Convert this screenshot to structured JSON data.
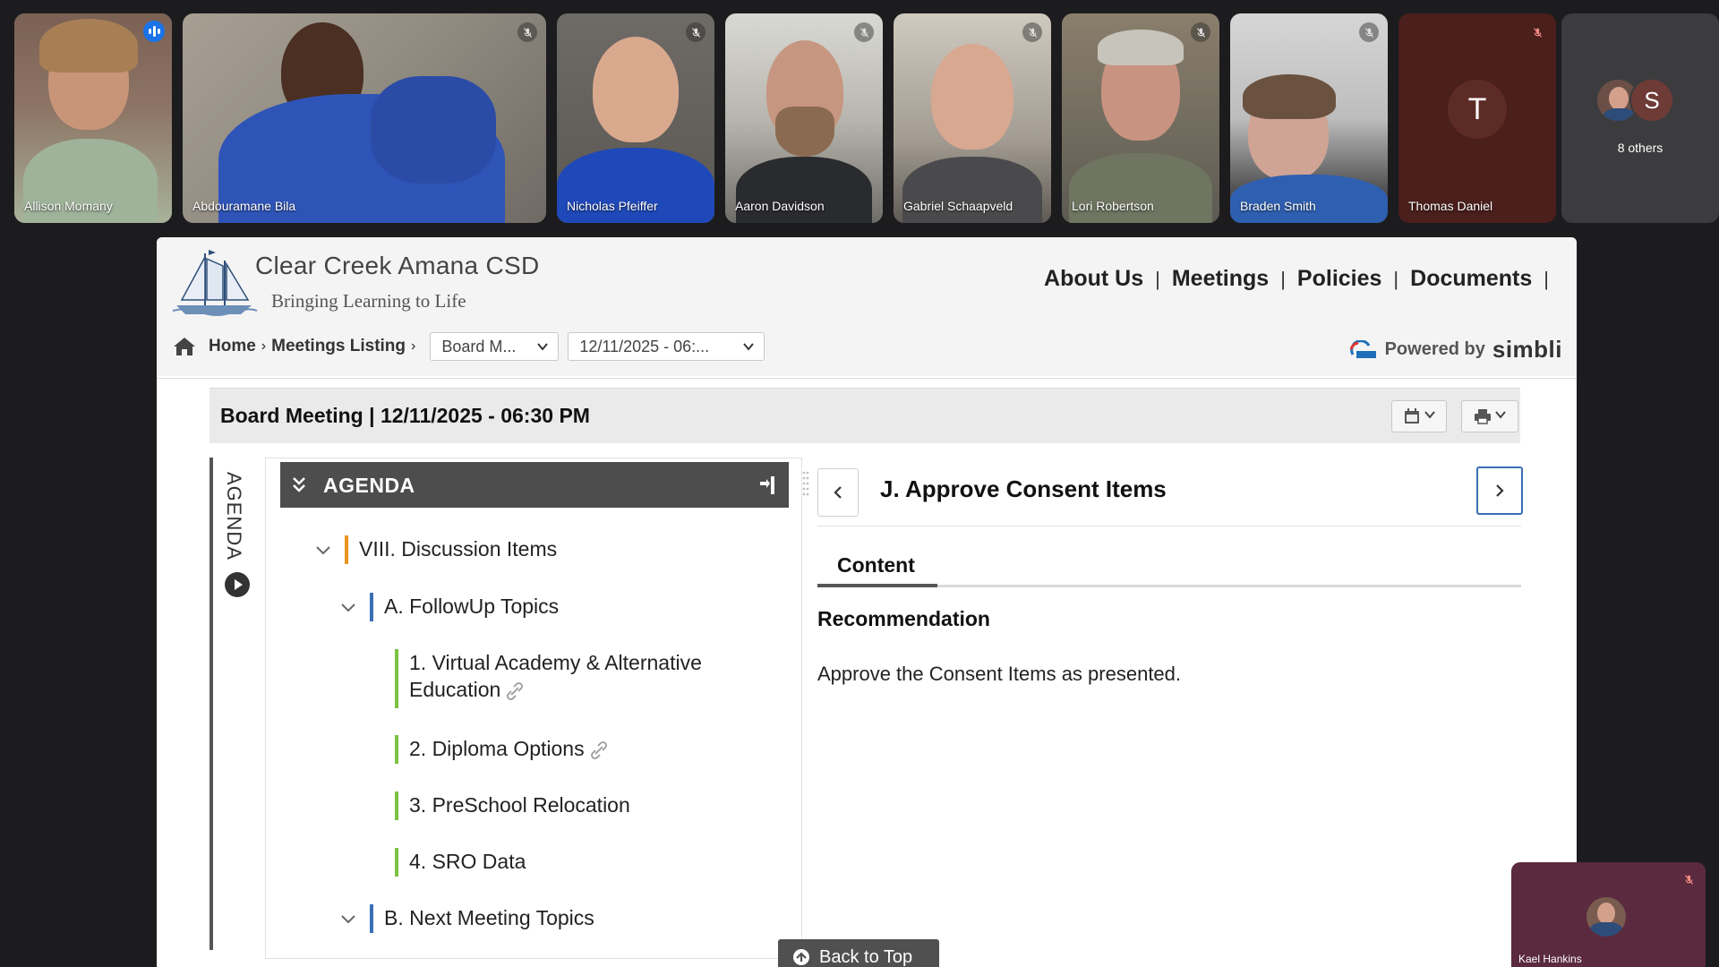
{
  "call": {
    "participants": [
      {
        "name": "Allison Momany",
        "speaking": true
      },
      {
        "name": "Abdouramane Bila",
        "muted": true
      },
      {
        "name": "Nicholas Pfeiffer",
        "muted": true
      },
      {
        "name": "Aaron Davidson",
        "muted": true
      },
      {
        "name": "Gabriel Schaapveld",
        "muted": true
      },
      {
        "name": "Lori Robertson",
        "muted": true
      },
      {
        "name": "Braden Smith",
        "muted": true
      },
      {
        "name": "Thomas Daniel",
        "initial": "T",
        "muted": true
      }
    ],
    "others": {
      "initial": "S",
      "label": "8 others"
    },
    "self": {
      "name": "Kael Hankins",
      "muted": true
    }
  },
  "site": {
    "org_name": "Clear Creek Amana CSD",
    "tagline": "Bringing Learning to Life",
    "nav": [
      "About Us",
      "Meetings",
      "Policies",
      "Documents"
    ],
    "separator": "|",
    "breadcrumb": {
      "home": "Home",
      "listing": "Meetings Listing",
      "meeting_type_select": "Board M...",
      "meeting_date_select": "12/11/2025 - 06:..."
    },
    "powered_by": "Powered by",
    "brand": "simbli"
  },
  "meeting": {
    "title": "Board Meeting | 12/11/2025 - 06:30 PM"
  },
  "agenda": {
    "rail_label": "AGENDA",
    "header": "AGENDA",
    "items": [
      {
        "label": "VIII. Discussion Items",
        "level": 0
      },
      {
        "label": "A. FollowUp Topics",
        "level": 1
      },
      {
        "label_line1": "1. Virtual Academy & Alternative",
        "label_line2": "Education",
        "level": 2,
        "attachment": true
      },
      {
        "label": "2. Diploma Options",
        "level": 2,
        "attachment": true
      },
      {
        "label": "3. PreSchool Relocation",
        "level": 2
      },
      {
        "label": "4. SRO Data",
        "level": 2
      },
      {
        "label": "B. Next Meeting Topics",
        "level": 1
      }
    ]
  },
  "detail": {
    "title": "J. Approve Consent Items",
    "tab": "Content",
    "section_heading": "Recommendation",
    "text": "Approve the Consent Items as presented."
  },
  "back_to_top": "Back to Top",
  "colors": {
    "discussion_bar": "#e8941f",
    "topic_bar": "#3a6fb6",
    "item_bar": "#7cc243",
    "speaking_blue": "#1a73e8",
    "next_button_border": "#3a6fb6"
  }
}
